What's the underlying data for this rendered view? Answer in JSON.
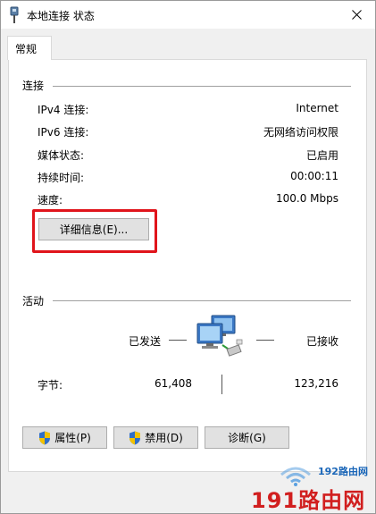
{
  "window": {
    "title": "本地连接 状态"
  },
  "tabs": [
    {
      "label": "常规"
    }
  ],
  "connection": {
    "group_label": "连接",
    "rows": [
      {
        "label": "IPv4 连接:",
        "value": "Internet"
      },
      {
        "label": "IPv6 连接:",
        "value": "无网络访问权限"
      },
      {
        "label": "媒体状态:",
        "value": "已启用"
      },
      {
        "label": "持续时间:",
        "value": "00:00:11"
      },
      {
        "label": "速度:",
        "value": "100.0 Mbps"
      }
    ],
    "details_button": "详细信息(E)..."
  },
  "activity": {
    "group_label": "活动",
    "sent_label": "已发送",
    "received_label": "已接收",
    "bytes_label": "字节:",
    "bytes_sent": "61,408",
    "bytes_received": "123,216"
  },
  "buttons": {
    "properties": "属性(P)",
    "disable": "禁用(D)",
    "diagnose": "诊断(G)"
  },
  "watermark": {
    "brand": "191路由网",
    "small": "192路由网"
  },
  "colors": {
    "highlight": "#e0141b",
    "watermark_red": "#d11f1f",
    "watermark_blue": "#1a66b8"
  },
  "icons": {
    "title": "network-adapter-icon",
    "activity": "network-computers-icon",
    "shield": "uac-shield-icon"
  }
}
